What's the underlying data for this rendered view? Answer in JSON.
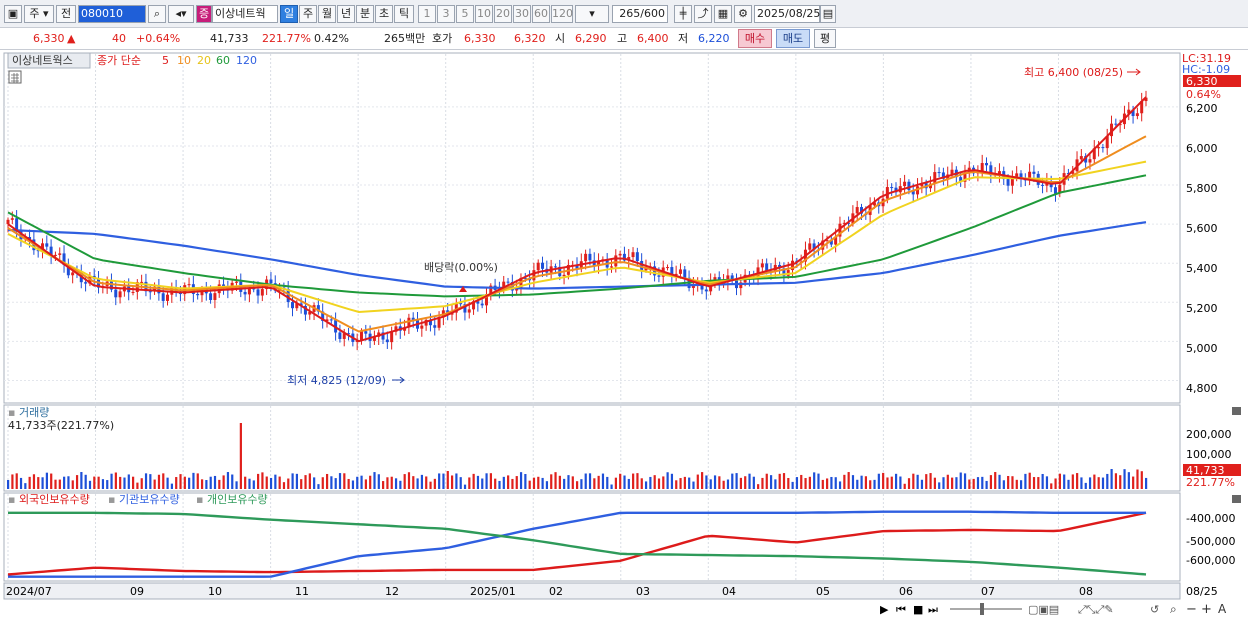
{
  "toolbar": {
    "type_label": "주",
    "prev_label": "전",
    "code_value": "080010",
    "name_badge": "증",
    "name_value": "이상네트웍",
    "periods": [
      "일",
      "주",
      "월",
      "년",
      "분",
      "초",
      "틱"
    ],
    "active_period": "일",
    "intervals": [
      "1",
      "3",
      "5",
      "10",
      "20",
      "30",
      "60",
      "120"
    ],
    "count_value": "265",
    "count_total": "/600",
    "date_value": "2025/08/25"
  },
  "quote": {
    "price": "6,330",
    "change": "40",
    "change_pct": "+0.64%",
    "volume": "41,733",
    "volume_ratio": "221.77%",
    "turnover": "0.42%",
    "amount": "265백만",
    "ask_label": "호가",
    "ask": "6,330",
    "bid": "6,320",
    "open_label": "시",
    "open": "6,290",
    "high_label": "고",
    "high": "6,400",
    "low_label": "저",
    "low": "6,220",
    "buy_label": "매수",
    "sell_label": "매도",
    "eval_label": "평"
  },
  "chart": {
    "legend_name": "이상네트웍스",
    "legend_ma_label": "종가 단순",
    "ma_periods": [
      "5",
      "10",
      "20",
      "60",
      "120"
    ],
    "ma_colors": [
      "#dd1b1b",
      "#ef8d1f",
      "#f1d31f",
      "#1f9a3a",
      "#2f5fe0"
    ],
    "lc_label": "LC:31.19",
    "hc_label": "HC:-1.09",
    "last_price_tag": "6,330",
    "last_pct_tag": "0.64%",
    "high_note": "최고 6,400 (08/25)",
    "low_note": "최저 4,825 (12/09)",
    "dividend_note": "배당락(0.00%)",
    "price_ticks": [
      "6,200",
      "6,000",
      "5,800",
      "5,600",
      "5,400",
      "5,200",
      "5,000",
      "4,800"
    ],
    "volume_title": "거래량",
    "volume_value": "41,733주(221.77%)",
    "volume_ticks": [
      "200,000",
      "100,000"
    ],
    "volume_tag": "41,733",
    "volume_pct_tag": "221.77%",
    "holders_legend": [
      "외국인보유수량",
      "기관보유수량",
      "개인보유수량"
    ],
    "holders_colors": [
      "#dd1b1b",
      "#2f5fe0",
      "#2e9a5a"
    ],
    "holders_ticks": [
      "-400,000",
      "-500,000",
      "-600,000"
    ],
    "x_labels": [
      "2024/07",
      "09",
      "10",
      "11",
      "12",
      "2025/01",
      "02",
      "03",
      "04",
      "05",
      "06",
      "07",
      "08",
      "08/25"
    ]
  },
  "chart_data": {
    "type": "line",
    "title": "이상네트웍스",
    "x": [
      "2024/07",
      "09",
      "10",
      "11",
      "12",
      "2025/01",
      "02",
      "03",
      "04",
      "05",
      "06",
      "07",
      "08",
      "08/25"
    ],
    "ylim": [
      4700,
      6450
    ],
    "series": [
      {
        "name": "5",
        "values": [
          5600,
          5280,
          5250,
          5280,
          5000,
          5130,
          5350,
          5430,
          5280,
          5400,
          5750,
          5880,
          5800,
          6250
        ]
      },
      {
        "name": "10",
        "values": [
          5580,
          5300,
          5260,
          5290,
          5050,
          5140,
          5330,
          5410,
          5290,
          5380,
          5720,
          5870,
          5810,
          6050
        ]
      },
      {
        "name": "20",
        "values": [
          5550,
          5320,
          5270,
          5290,
          5150,
          5180,
          5300,
          5380,
          5300,
          5350,
          5650,
          5840,
          5830,
          5920
        ]
      },
      {
        "name": "60",
        "values": [
          5660,
          5420,
          5350,
          5290,
          5250,
          5230,
          5240,
          5270,
          5310,
          5330,
          5420,
          5580,
          5760,
          5850
        ]
      },
      {
        "name": "120",
        "values": [
          5570,
          5550,
          5490,
          5420,
          5340,
          5280,
          5270,
          5280,
          5290,
          5300,
          5350,
          5440,
          5540,
          5610
        ]
      }
    ],
    "events": [
      {
        "label": "최고 6,400 (08/25)",
        "value": 6400
      },
      {
        "label": "최저 4,825 (12/09)",
        "value": 4825
      },
      {
        "label": "배당락(0.00%)"
      }
    ],
    "volume_last": 41733,
    "holders": {
      "ylim": [
        -680000,
        -360000
      ],
      "series": [
        {
          "name": "외국인보유수량",
          "values": [
            -660000,
            -630000,
            -645000,
            -650000,
            -645000,
            -640000,
            -640000,
            -600000,
            -490000,
            -520000,
            -470000,
            -465000,
            -470000,
            -390000
          ]
        },
        {
          "name": "기관보유수량",
          "values": [
            -670000,
            -670000,
            -670000,
            -670000,
            -580000,
            -545000,
            -460000,
            -390000,
            -390000,
            -390000,
            -385000,
            -385000,
            -390000,
            -390000
          ]
        },
        {
          "name": "개인보유수량",
          "values": [
            -390000,
            -390000,
            -395000,
            -420000,
            -440000,
            -460000,
            -510000,
            -570000,
            -575000,
            -580000,
            -590000,
            -605000,
            -630000,
            -660000
          ]
        }
      ]
    }
  }
}
